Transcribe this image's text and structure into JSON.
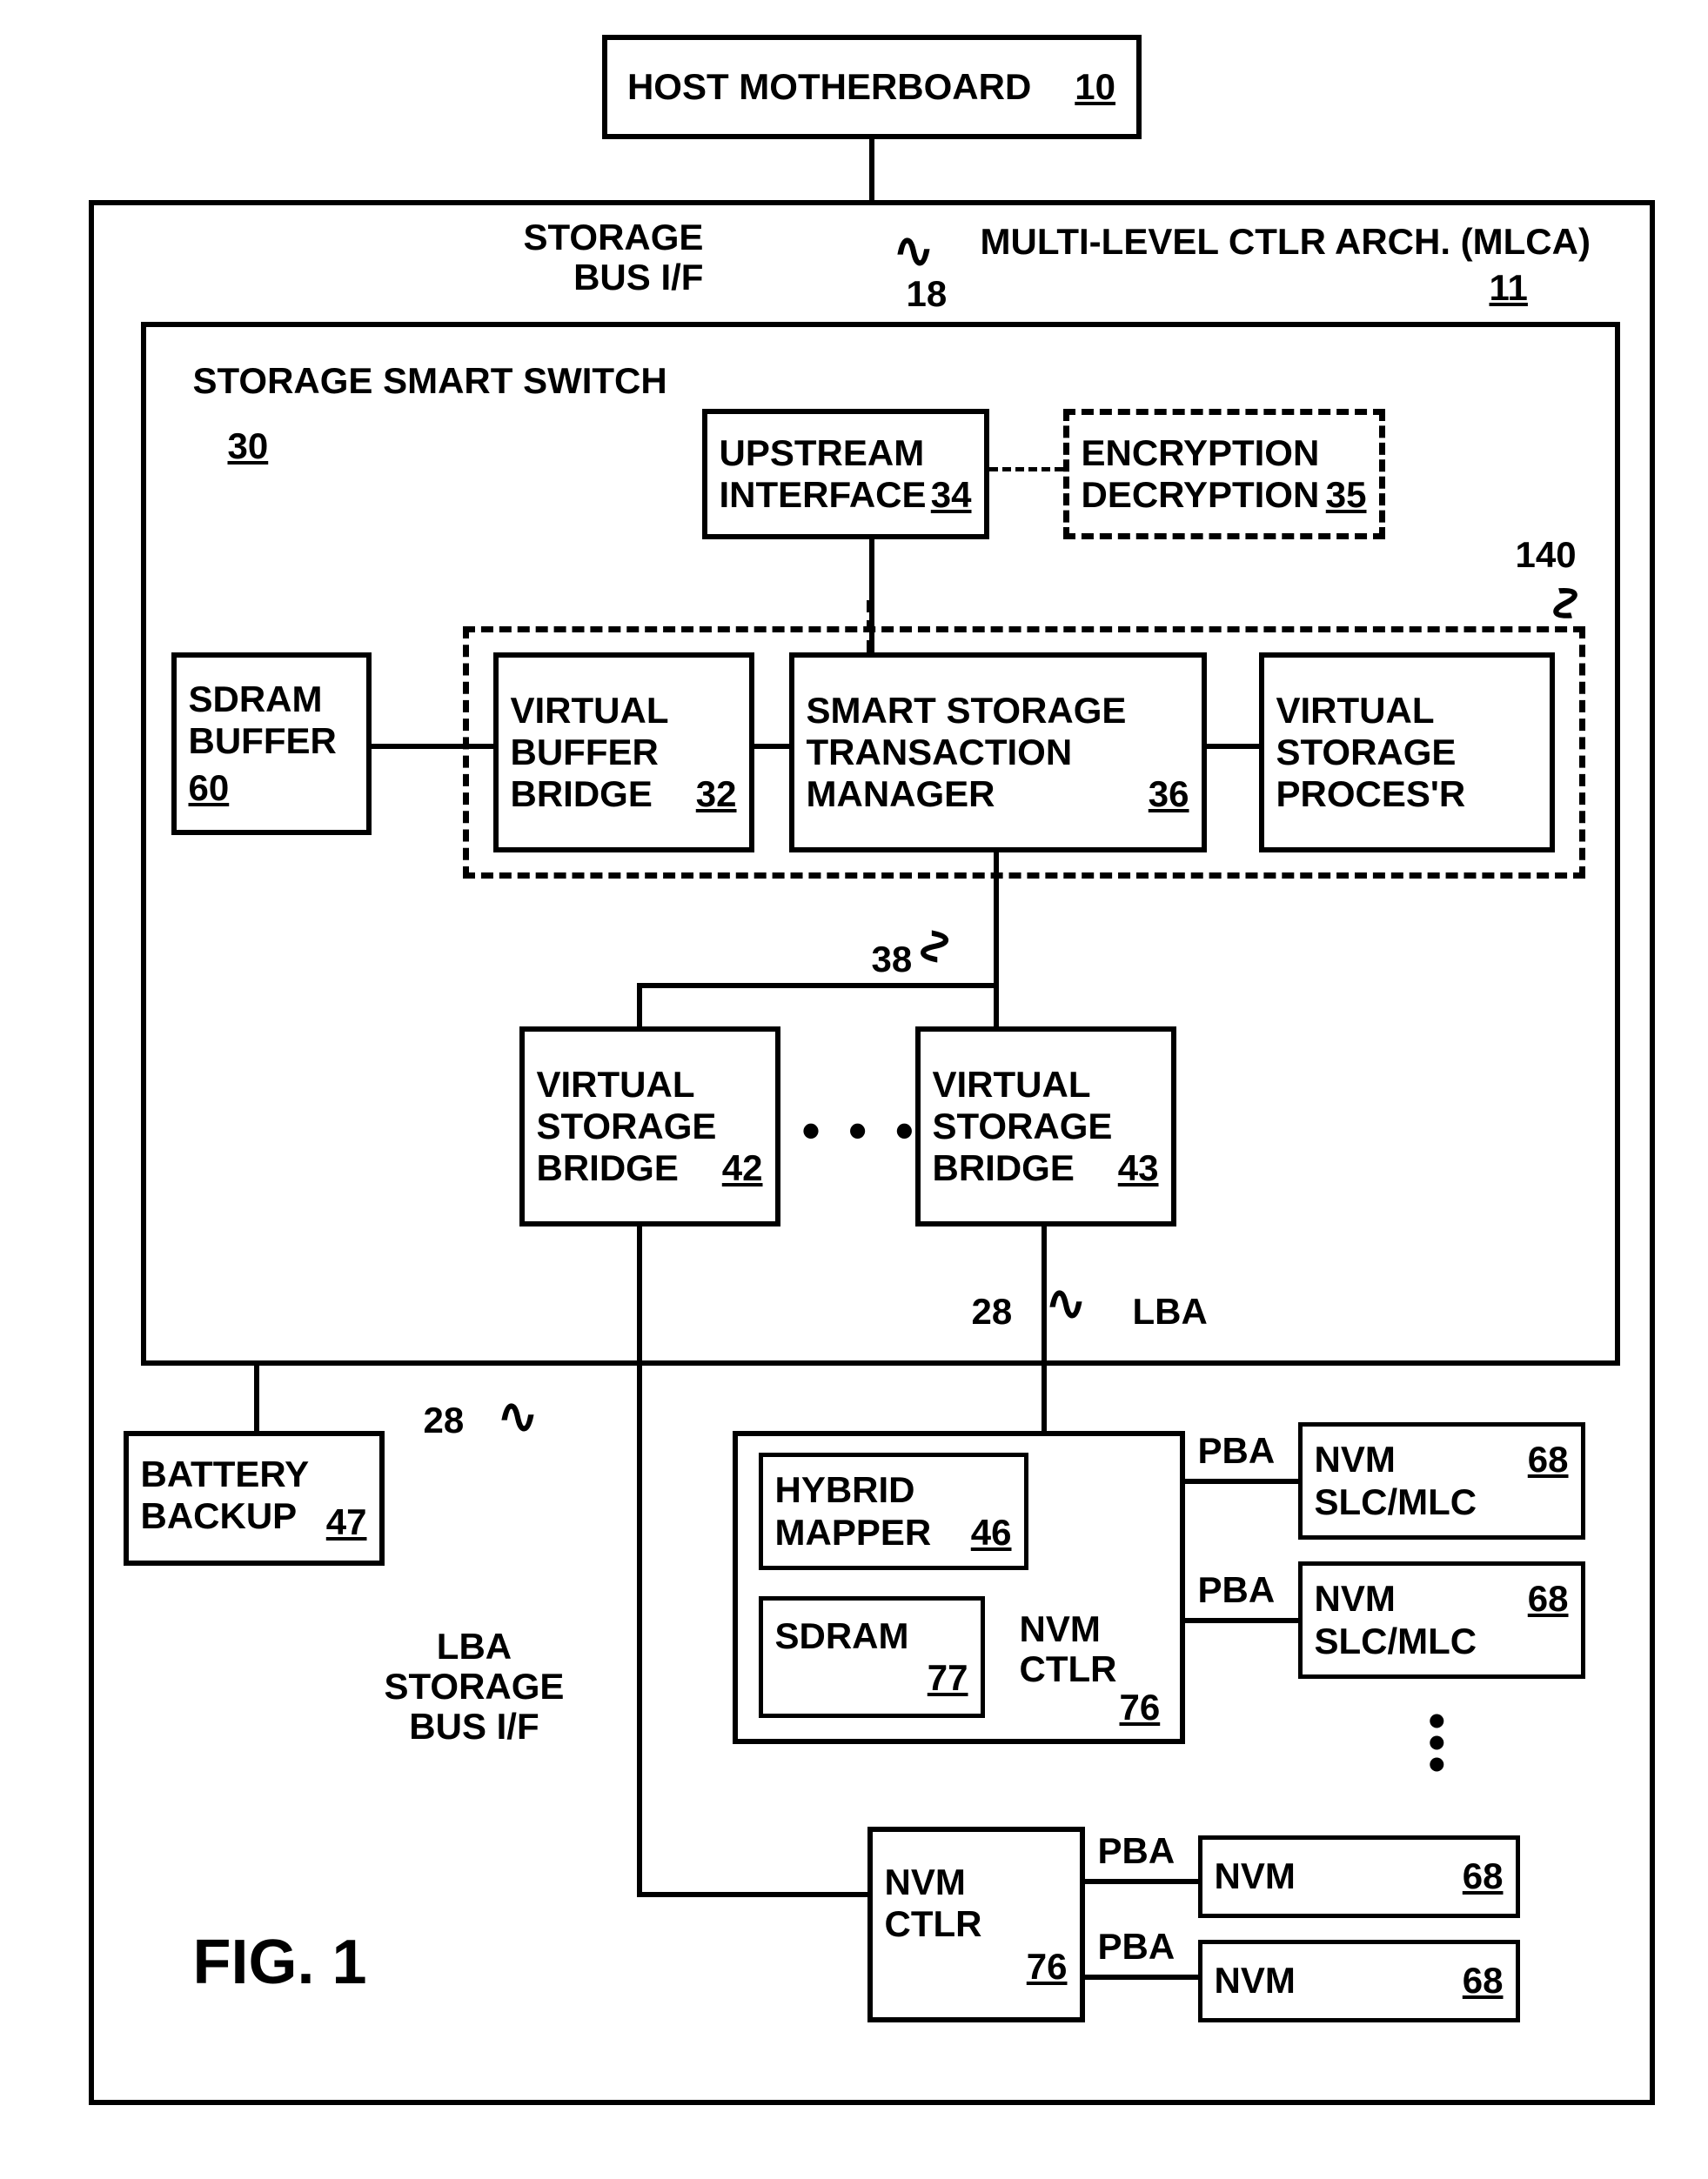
{
  "figure_label": "FIG. 1",
  "host": {
    "label": "HOST MOTHERBOARD",
    "ref": "10"
  },
  "mlca": {
    "label": "MULTI-LEVEL CTLR ARCH. (MLCA)",
    "ref": "11"
  },
  "storage_bus_if_top": {
    "label": "STORAGE\nBUS I/F"
  },
  "ref18": "18",
  "switch": {
    "label": "STORAGE SMART SWITCH",
    "ref": "30"
  },
  "upstream": {
    "label": "UPSTREAM\nINTERFACE",
    "ref": "34"
  },
  "encdec": {
    "label": "ENCRYPTION\nDECRYPTION",
    "ref": "35"
  },
  "ref140": "140",
  "sdram_buf": {
    "label": "SDRAM\nBUFFER",
    "ref": "60"
  },
  "vbb": {
    "label": "VIRTUAL\nBUFFER\nBRIDGE",
    "ref": "32"
  },
  "sstm": {
    "label": "SMART STORAGE\nTRANSACTION\nMANAGER",
    "ref": "36"
  },
  "vsp": {
    "label": "VIRTUAL\nSTORAGE\nPROCES'R"
  },
  "ref38": "38",
  "vsb1": {
    "label": "VIRTUAL\nSTORAGE\nBRIDGE",
    "ref": "42"
  },
  "vsb2": {
    "label": "VIRTUAL\nSTORAGE\nBRIDGE",
    "ref": "43"
  },
  "ref28a": "28",
  "ref28b": "28",
  "lba": "LBA",
  "battery": {
    "label": "BATTERY\nBACKUP",
    "ref": "47"
  },
  "lba_storage_bus_if": "LBA\nSTORAGE\nBUS I/F",
  "nvm_ctlr_a": {
    "label": "NVM\nCTLR",
    "ref": "76"
  },
  "hybrid": {
    "label": "HYBRID\nMAPPER",
    "ref": "46"
  },
  "sdram77": {
    "label": "SDRAM",
    "ref": "77"
  },
  "nvm_ctlr_b": {
    "label": "NVM\nCTLR",
    "ref": "76"
  },
  "pba": "PBA",
  "nvm68": {
    "label": "NVM",
    "ref": "68"
  },
  "slcmlc": "SLC/MLC",
  "dots": "• • •",
  "vdots": "•\n•\n•",
  "squiggle": "∿"
}
